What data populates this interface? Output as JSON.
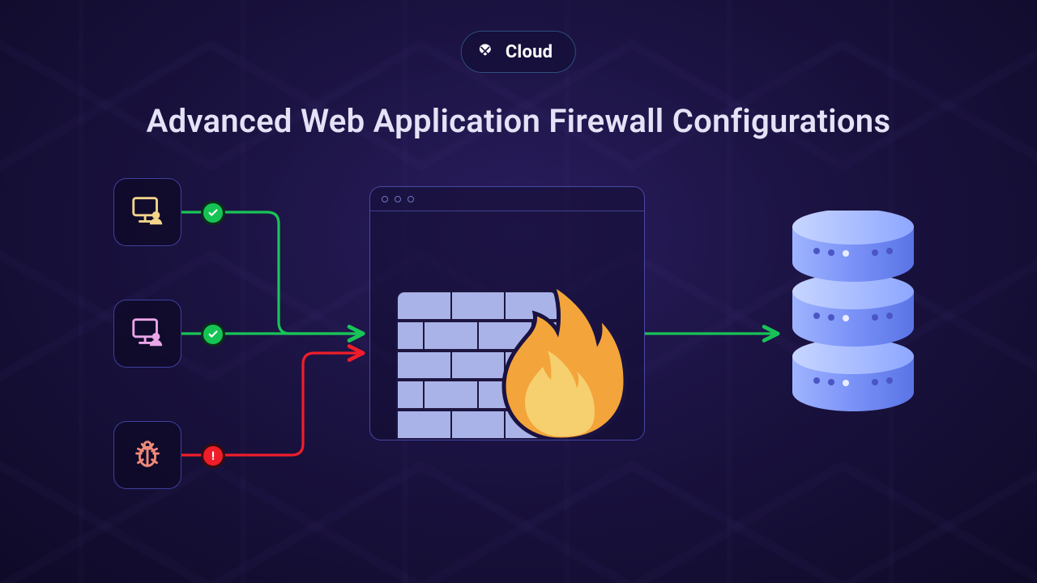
{
  "brand": {
    "name": "Cloud"
  },
  "title": "Advanced Web Application Firewall Configurations",
  "colors": {
    "allow": "#18c457",
    "block": "#ef1d2a",
    "border": "#6a72ff",
    "brick": "#a9b3e8",
    "flame_outer": "#f3a43a",
    "flame_inner": "#f6cf6f",
    "db_light": "#8ea7ff",
    "db_dark": "#5a74e6"
  },
  "clients": [
    {
      "kind": "user",
      "status": "allow",
      "icon_color": "#f2d58a"
    },
    {
      "kind": "user",
      "status": "allow",
      "icon_color": "#eaa6e8"
    },
    {
      "kind": "threat",
      "status": "block",
      "icon_color": "#f08a7a"
    }
  ],
  "firewall": {
    "window_dots": 3,
    "label": "firewall"
  },
  "database": {
    "disks": 3
  },
  "arrows": [
    {
      "from": "client-1",
      "to": "firewall",
      "status": "allow"
    },
    {
      "from": "client-2",
      "to": "firewall",
      "status": "allow"
    },
    {
      "from": "client-3",
      "to": "firewall",
      "status": "block"
    },
    {
      "from": "firewall",
      "to": "database",
      "status": "allow"
    }
  ]
}
